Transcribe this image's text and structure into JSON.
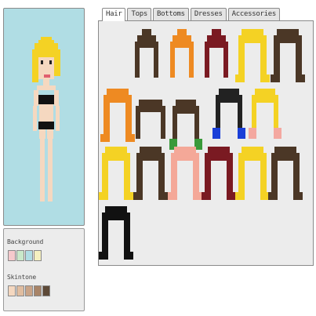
{
  "tabs": [
    "Hair",
    "Tops",
    "Bottoms",
    "Dresses",
    "Accessories"
  ],
  "active_tab": "Hair",
  "swatches": {
    "background_label": "Background",
    "background_colors": [
      "#f5c9cc",
      "#c9e8c9",
      "#b0dde4",
      "#f5f0c0"
    ],
    "skintone_label": "Skintone",
    "skintone_colors": [
      "#f5d8c0",
      "#e0bda0",
      "#c9a488",
      "#a88468",
      "#5e4a38"
    ]
  },
  "character": {
    "hair_color": "#f4d224",
    "skin_color": "#f5d8c0",
    "top_color": "#111111",
    "bottom_color": "#111111",
    "lip_color": "#e06070",
    "eye_color": "#222222"
  },
  "hair_options": [
    {
      "name": "hair-option-1",
      "style": "bun",
      "color": "#4b3726"
    },
    {
      "name": "hair-option-2",
      "style": "bun",
      "color": "#ee8a22"
    },
    {
      "name": "hair-option-3",
      "style": "bun",
      "color": "#7a1a22"
    },
    {
      "name": "hair-option-4",
      "style": "long",
      "color": "#f4d224"
    },
    {
      "name": "hair-option-5",
      "style": "long",
      "color": "#4b3726"
    },
    {
      "name": "hair-option-6",
      "style": "long",
      "color": "#ee8a22"
    },
    {
      "name": "hair-option-7",
      "style": "short",
      "color": "#4b3726"
    },
    {
      "name": "hair-option-8",
      "style": "ribbon",
      "color": "#4b3726",
      "accent": "#3a9a3a"
    },
    {
      "name": "hair-option-9",
      "style": "ribbon",
      "color": "#222222",
      "accent": "#1a3fd8"
    },
    {
      "name": "hair-option-10",
      "style": "ribbon",
      "color": "#f4d224",
      "accent": "#f4a8a0"
    },
    {
      "name": "hair-option-11",
      "style": "long",
      "color": "#f4d224"
    },
    {
      "name": "hair-option-12",
      "style": "long",
      "color": "#4b3726"
    },
    {
      "name": "hair-option-13",
      "style": "long",
      "color": "#f4a898"
    },
    {
      "name": "hair-option-14",
      "style": "long",
      "color": "#7a1a22"
    },
    {
      "name": "hair-option-15",
      "style": "long",
      "color": "#f4d224"
    },
    {
      "name": "hair-option-16",
      "style": "long",
      "color": "#4b3726"
    },
    {
      "name": "hair-option-17",
      "style": "long",
      "color": "#111111"
    }
  ]
}
